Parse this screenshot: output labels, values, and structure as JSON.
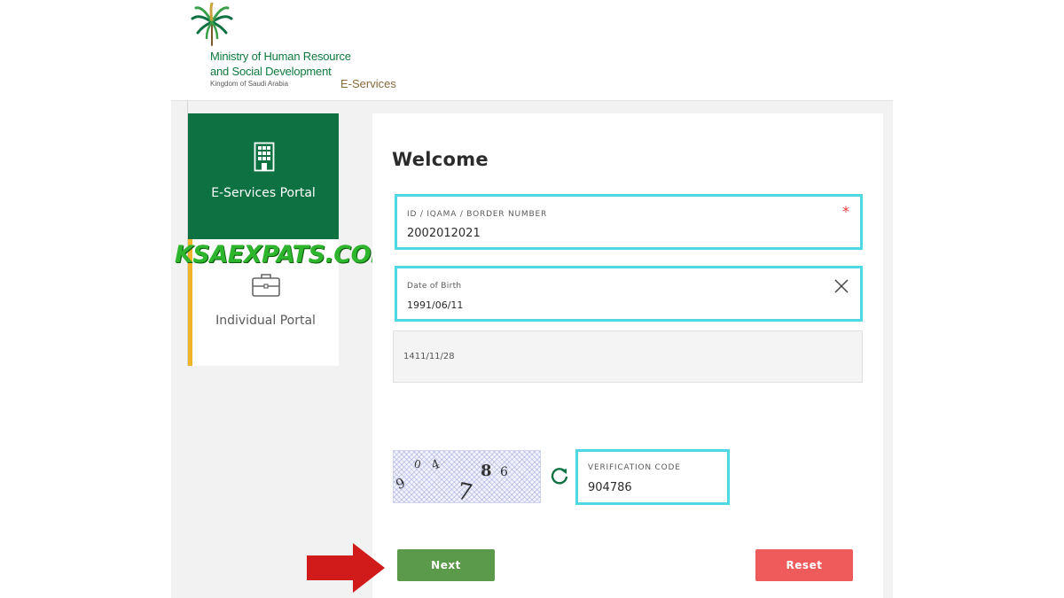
{
  "header": {
    "logo": {
      "line1": "Ministry of Human Resource",
      "line2": "and Social Development",
      "line3": "Kingdom of Saudi Arabia",
      "suffix": "E-Services"
    }
  },
  "sidebar": {
    "items": [
      {
        "label": "E-Services Portal",
        "icon": "building-icon",
        "active": true
      },
      {
        "label": "Individual Portal",
        "icon": "briefcase-icon",
        "active": false
      }
    ]
  },
  "watermark": "KSAEXPATS.COM",
  "form": {
    "title": "Welcome",
    "id_field": {
      "label": "ID / IQAMA / BORDER NUMBER",
      "value": "2002012021",
      "required_mark": "*"
    },
    "dob_field": {
      "label": "Date of Birth",
      "value": "1991/06/11"
    },
    "hijri_field": {
      "value": "1411/11/28"
    },
    "captcha": {
      "characters": [
        "9",
        "0",
        "4",
        "7",
        "8",
        "6"
      ]
    },
    "verification_field": {
      "label": "VERIFICATION CODE",
      "value": "904786"
    },
    "buttons": {
      "next": "Next",
      "reset": "Reset"
    }
  },
  "colors": {
    "brand_green": "#0e7142",
    "highlight_cyan": "#4fd8e4",
    "next_green": "#5a9a4a",
    "reset_red": "#ef5a5a",
    "arrow_red": "#d11a1a",
    "accent_yellow": "#f0b429"
  }
}
